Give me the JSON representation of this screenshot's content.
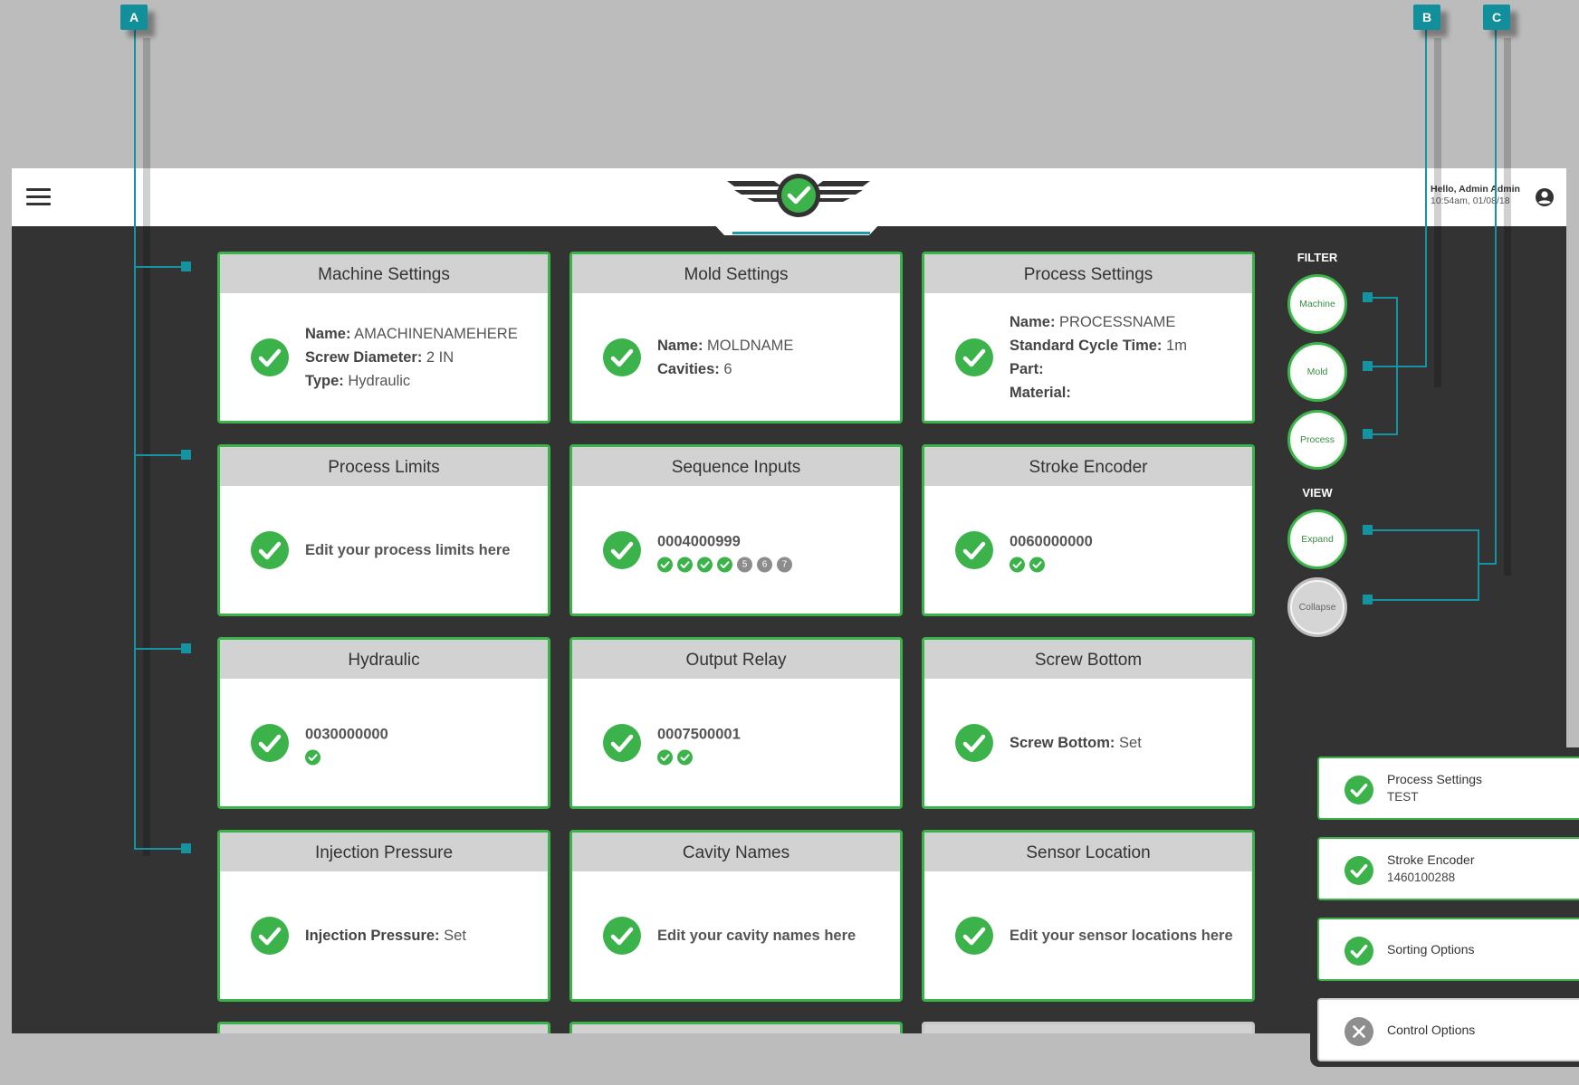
{
  "header": {
    "greeting": "Hello, Admin Admin",
    "timestamp": "10:54am, 01/08/18",
    "menu_icon": "hamburger-menu-icon",
    "user_icon": "user-circle-icon",
    "logo_icon": "winged-check-logo"
  },
  "callouts": {
    "a": "A",
    "b": "B",
    "c": "C"
  },
  "cards": [
    {
      "title": "Machine Settings",
      "lines": [
        {
          "label": "Name:",
          "value": "AMACHINENAMEHERE"
        },
        {
          "label": "Screw Diameter:",
          "value": "2 IN"
        },
        {
          "label": "Type:",
          "value": "Hydraulic"
        }
      ]
    },
    {
      "title": "Mold Settings",
      "lines": [
        {
          "label": "Name:",
          "value": "MOLDNAME"
        },
        {
          "label": "Cavities:",
          "value": "6"
        }
      ]
    },
    {
      "title": "Process Settings",
      "lines": [
        {
          "label": "Name:",
          "value": "PROCESSNAME"
        },
        {
          "label": "Standard Cycle Time:",
          "value": "1m"
        },
        {
          "label": "Part:",
          "value": ""
        },
        {
          "label": "Material:",
          "value": ""
        }
      ]
    },
    {
      "title": "Process Limits",
      "text": "Edit your process limits here"
    },
    {
      "title": "Sequence Inputs",
      "code": "0004000999",
      "dots": [
        "ok",
        "ok",
        "ok",
        "ok",
        "5",
        "6",
        "7"
      ]
    },
    {
      "title": "Stroke Encoder",
      "code": "0060000000",
      "dots": [
        "ok",
        "ok"
      ]
    },
    {
      "title": "Hydraulic",
      "code": "0030000000",
      "dots": [
        "ok"
      ]
    },
    {
      "title": "Output Relay",
      "code": "0007500001",
      "dots": [
        "ok",
        "ok"
      ]
    },
    {
      "title": "Screw Bottom",
      "lines": [
        {
          "label": "Screw Bottom:",
          "value": "Set"
        }
      ]
    },
    {
      "title": "Injection Pressure",
      "lines": [
        {
          "label": "Injection Pressure:",
          "value": "Set"
        }
      ]
    },
    {
      "title": "Cavity Names",
      "text": "Edit your cavity names here"
    },
    {
      "title": "Sensor Location",
      "text": "Edit your sensor locations here"
    }
  ],
  "filter": {
    "label": "FILTER",
    "buttons": [
      "Machine",
      "Mold",
      "Process"
    ]
  },
  "view": {
    "label": "VIEW",
    "buttons": [
      "Expand",
      "Collapse"
    ]
  },
  "toasts": [
    {
      "title": "Process Settings",
      "sub": "TEST",
      "status": "ok"
    },
    {
      "title": "Stroke Encoder",
      "sub": "1460100288",
      "status": "ok"
    },
    {
      "title": "Sorting Options",
      "sub": "",
      "status": "ok"
    },
    {
      "title": "Control Options",
      "sub": "",
      "status": "closed"
    }
  ],
  "colors": {
    "accent_green": "#3cb34a",
    "callout_teal": "#1494a0",
    "app_bg": "#333333"
  }
}
